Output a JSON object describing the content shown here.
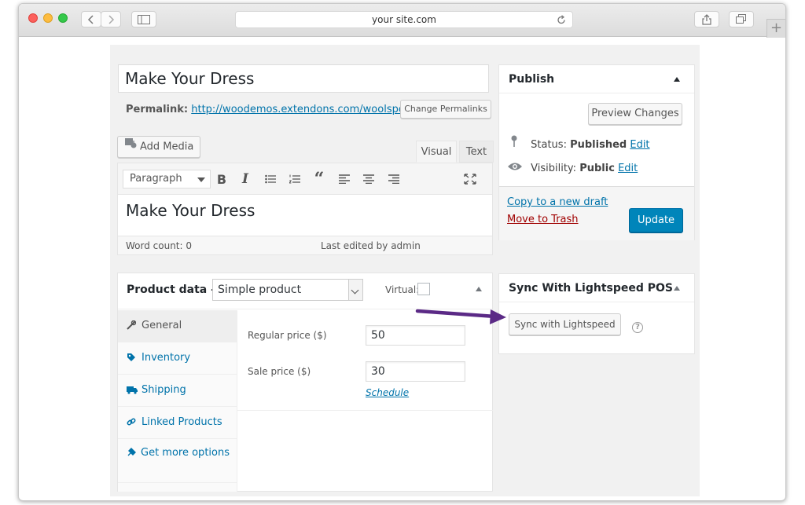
{
  "browser": {
    "url": "your site.com"
  },
  "post": {
    "title": "Make Your Dress",
    "permalink_label": "Permalink:",
    "permalink_url": "http://woodemos.extendons.com/woolspos/?pdi",
    "change_permalinks": "Change Permalinks",
    "add_media": "Add Media"
  },
  "editor": {
    "tabs": [
      "Visual",
      "Text"
    ],
    "active_tab": "Visual",
    "format_select": "Paragraph",
    "toolbar_icons": [
      "bold-icon",
      "italic-icon",
      "bullet-list-icon",
      "numbered-list-icon",
      "blockquote-icon",
      "align-left-icon",
      "align-center-icon",
      "align-right-icon",
      "fullscreen-icon"
    ],
    "content": "Make Your Dress",
    "word_count": "Word count: 0",
    "last_edited": "Last edited by admin"
  },
  "product_data": {
    "title": "Product data —",
    "type": "Simple product",
    "virtual_label": "Virtual:",
    "virtual_checked": false,
    "tabs": [
      "General",
      "Inventory",
      "Shipping",
      "Linked Products",
      "Get more options"
    ],
    "active_tab": "General",
    "regular_price_label": "Regular price ($)",
    "regular_price": "50",
    "sale_price_label": "Sale price ($)",
    "sale_price": "30",
    "schedule_link": "Schedule"
  },
  "publish": {
    "title": "Publish",
    "preview_button": "Preview Changes",
    "status_label": "Status:",
    "status_value": "Published",
    "visibility_label": "Visibility:",
    "visibility_value": "Public",
    "edit_link": "Edit",
    "copy_draft": "Copy to a new draft",
    "move_trash": "Move to Trash",
    "update_button": "Update"
  },
  "sync": {
    "title": "Sync With Lightspeed POS",
    "button": "Sync with Lightspeed",
    "help_icon": "help-icon"
  },
  "colors": {
    "link": "#0073aa",
    "primary_button": "#0085ba",
    "trash": "#a00000",
    "annotation_arrow": "#5b2a86"
  }
}
